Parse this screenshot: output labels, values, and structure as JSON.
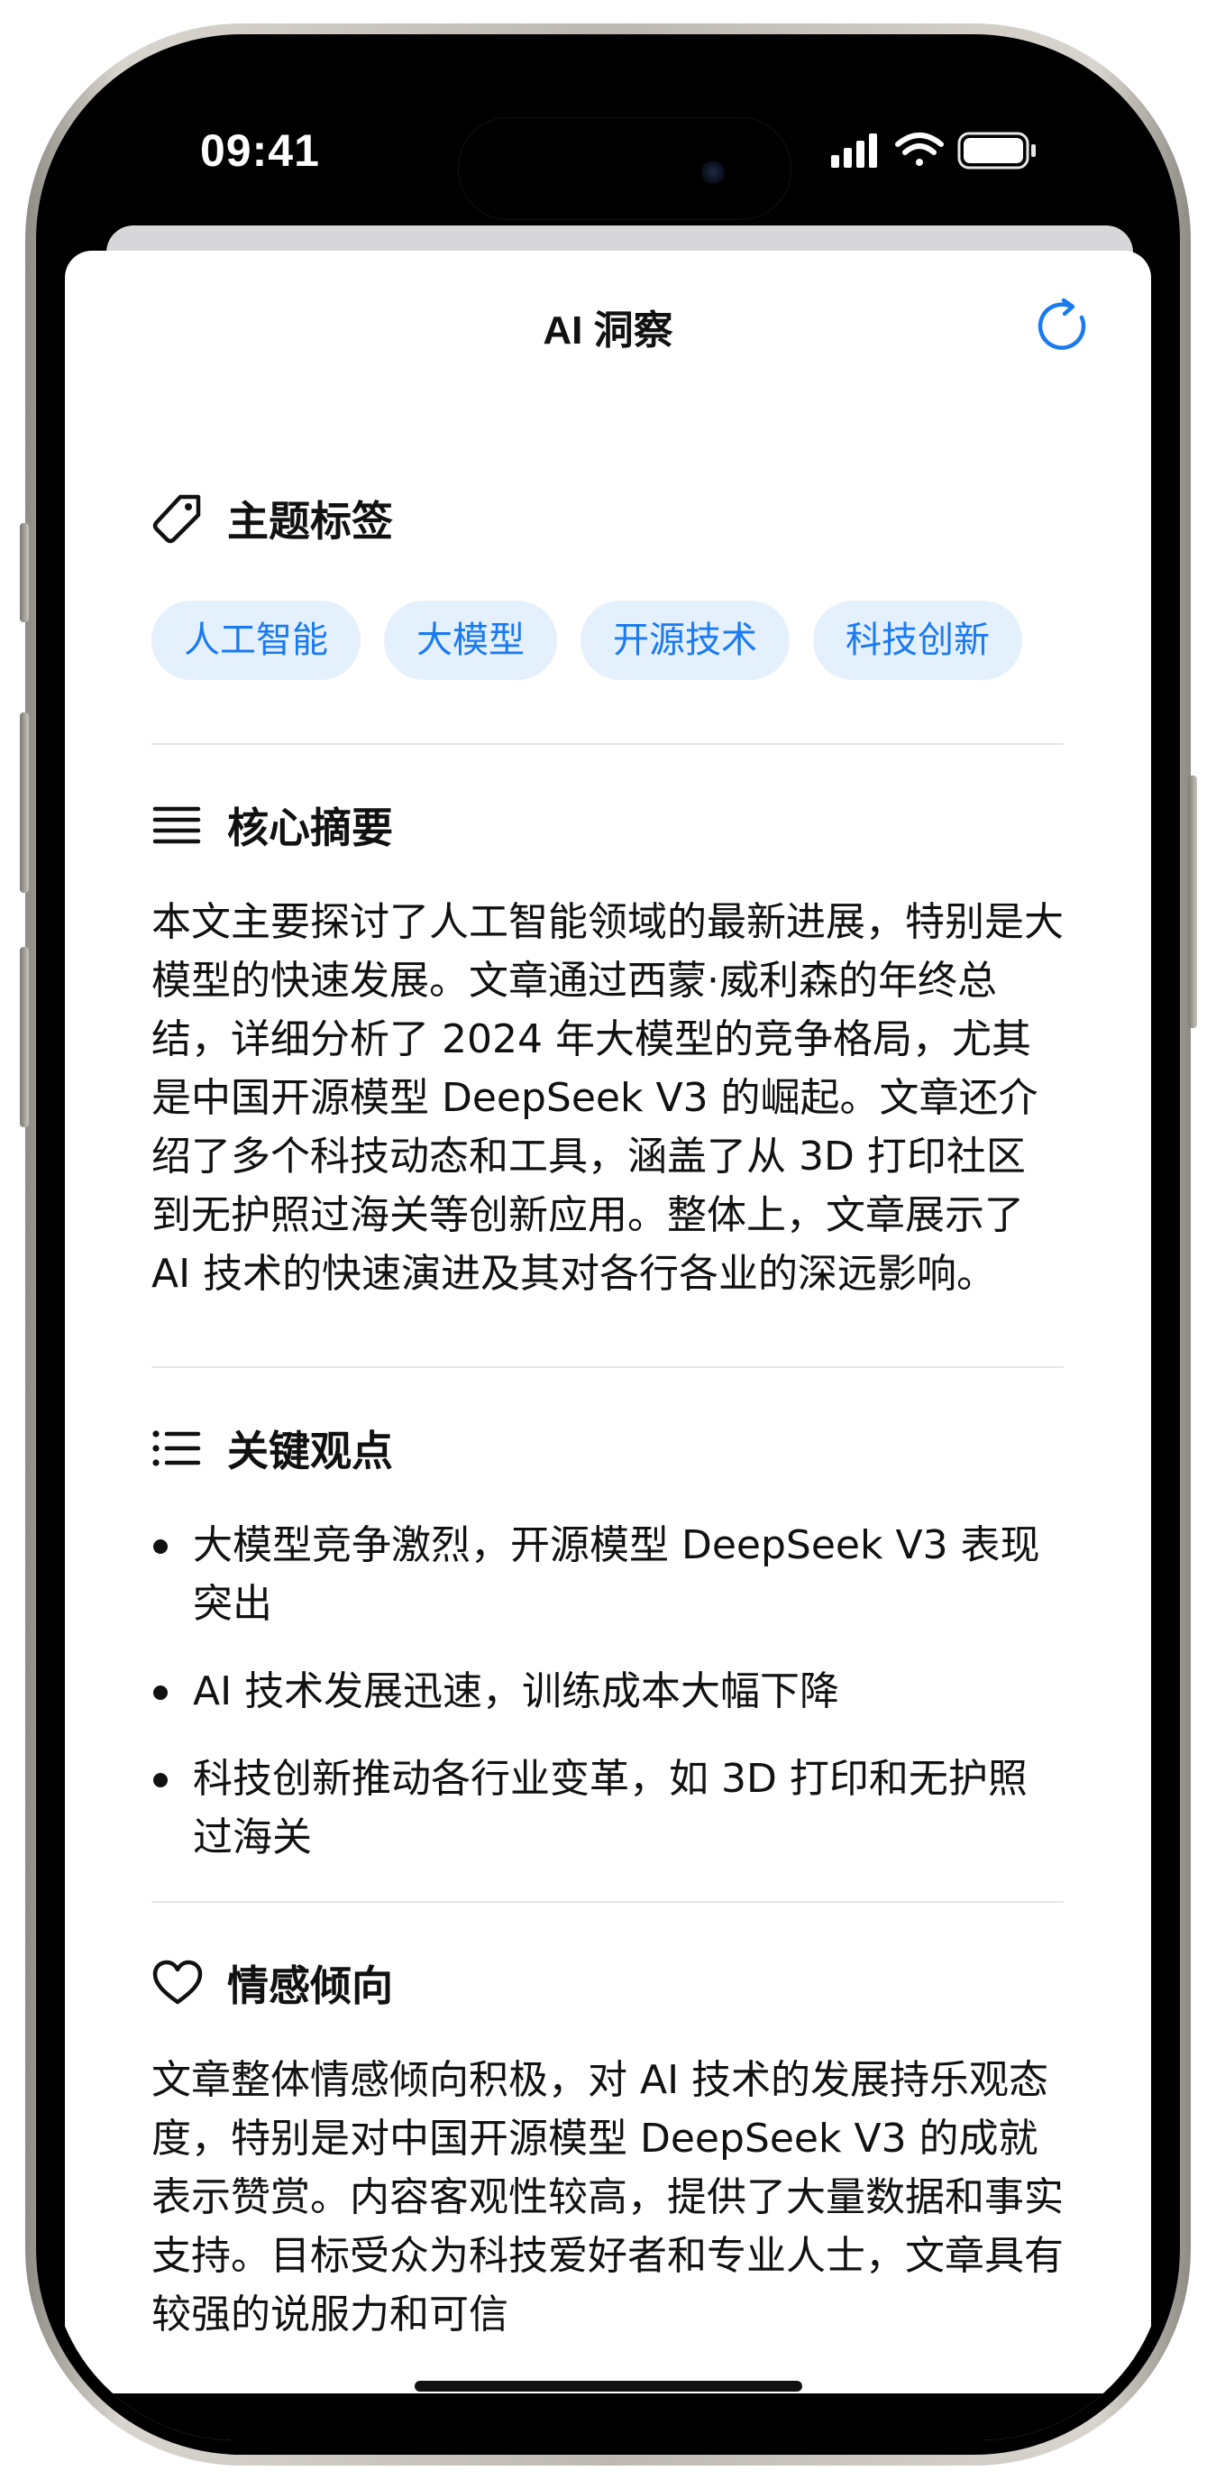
{
  "status_bar": {
    "time": "09:41",
    "icons": [
      "cellular-signal-icon",
      "wifi-icon",
      "battery-icon"
    ]
  },
  "sheet": {
    "title": "AI 洞察",
    "refresh_icon": "refresh-icon"
  },
  "tags_section": {
    "icon": "tag-icon",
    "heading": "主题标签",
    "tags": [
      "人工智能",
      "大模型",
      "开源技术",
      "科技创新"
    ]
  },
  "summary_section": {
    "icon": "lines-icon",
    "heading": "核心摘要",
    "text": "本文主要探讨了人工智能领域的最新进展，特别是大模型的快速发展。文章通过西蒙·威利森的年终总结，详细分析了 2024 年大模型的竞争格局，尤其是中国开源模型 DeepSeek V3 的崛起。文章还介绍了多个科技动态和工具，涵盖了从 3D 打印社区到无护照过海关等创新应用。整体上，文章展示了 AI 技术的快速演进及其对各行各业的深远影响。"
  },
  "keypoints_section": {
    "icon": "list-icon",
    "heading": "关键观点",
    "points": [
      "大模型竞争激烈，开源模型 DeepSeek V3 表现突出",
      "AI 技术发展迅速，训练成本大幅下降",
      "科技创新推动各行业变革，如 3D 打印和无护照过海关"
    ]
  },
  "sentiment_section": {
    "icon": "heart-icon",
    "heading": "情感倾向",
    "text": "文章整体情感倾向积极，对 AI 技术的发展持乐观态度，特别是对中国开源模型 DeepSeek V3 的成就表示赞赏。内容客观性较高，提供了大量数据和事实支持。目标受众为科技爱好者和专业人士，文章具有较强的说服力和可信"
  },
  "colors": {
    "accent": "#1a7af0",
    "tag_bg": "#e5f0fd",
    "text": "#111111",
    "divider": "#e6e6e8"
  }
}
